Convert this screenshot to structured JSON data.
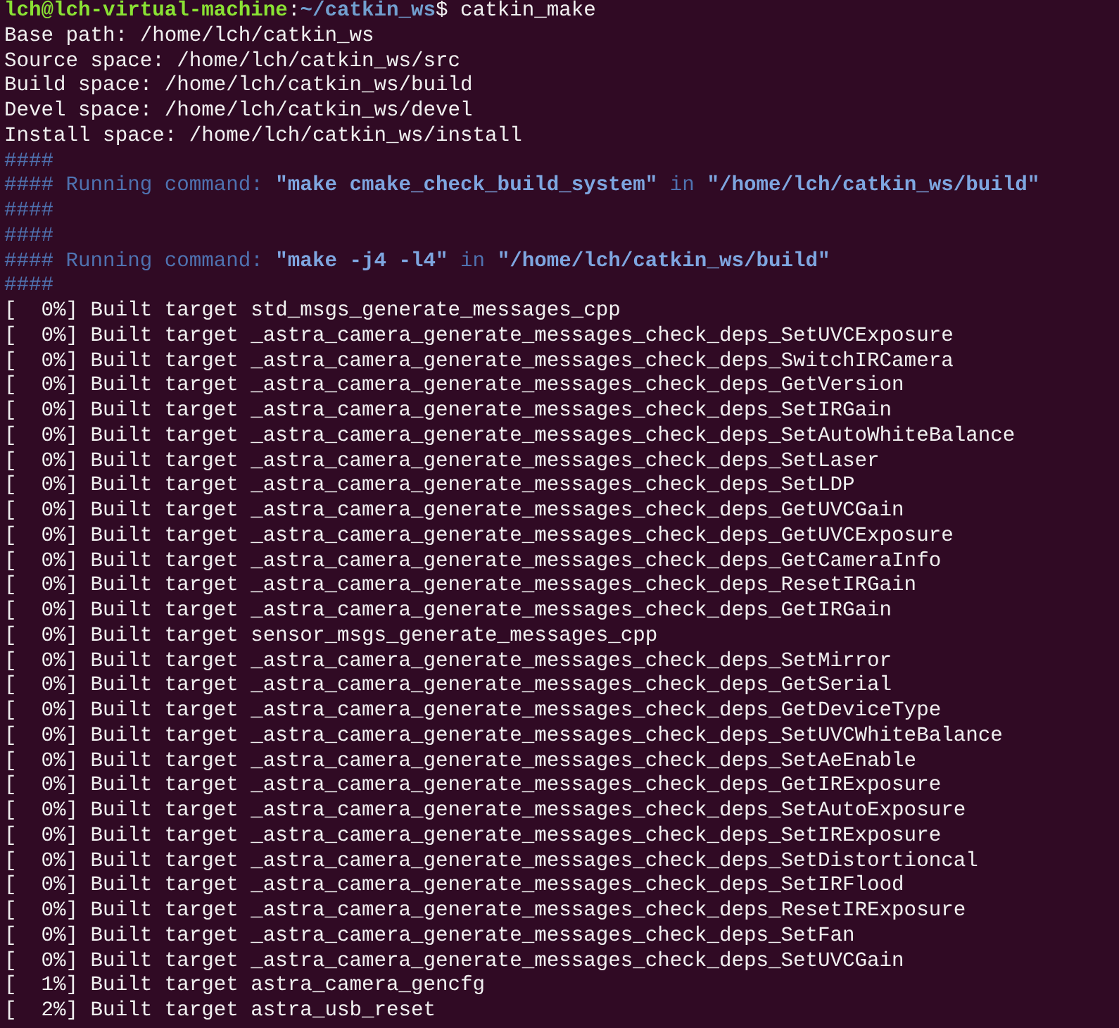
{
  "terminal": {
    "lines": [
      {
        "segments": [
          {
            "text": "lch@lch-virtual-machine",
            "kind": "user"
          },
          {
            "text": ":",
            "kind": "plain"
          },
          {
            "text": "~/catkin_ws",
            "kind": "path"
          },
          {
            "text": "$ catkin_make",
            "kind": "plain"
          }
        ]
      },
      {
        "text": "Base path: /home/lch/catkin_ws"
      },
      {
        "text": "Source space: /home/lch/catkin_ws/src"
      },
      {
        "text": "Build space: /home/lch/catkin_ws/build"
      },
      {
        "text": "Devel space: /home/lch/catkin_ws/devel"
      },
      {
        "text": "Install space: /home/lch/catkin_ws/install"
      },
      {
        "segments": [
          {
            "text": "####",
            "kind": "info"
          }
        ]
      },
      {
        "segments": [
          {
            "text": "#### Running command: ",
            "kind": "info"
          },
          {
            "text": "\"make cmake_check_build_system\"",
            "kind": "strong"
          },
          {
            "text": " in ",
            "kind": "info"
          },
          {
            "text": "\"/home/lch/catkin_ws/build\"",
            "kind": "strong"
          }
        ]
      },
      {
        "segments": [
          {
            "text": "####",
            "kind": "info"
          }
        ]
      },
      {
        "segments": [
          {
            "text": "####",
            "kind": "info"
          }
        ]
      },
      {
        "segments": [
          {
            "text": "#### Running command: ",
            "kind": "info"
          },
          {
            "text": "\"make -j4 -l4\"",
            "kind": "strong"
          },
          {
            "text": " in ",
            "kind": "info"
          },
          {
            "text": "\"/home/lch/catkin_ws/build\"",
            "kind": "strong"
          }
        ]
      },
      {
        "segments": [
          {
            "text": "####",
            "kind": "info"
          }
        ]
      },
      {
        "text": "[  0%] Built target std_msgs_generate_messages_cpp"
      },
      {
        "text": "[  0%] Built target _astra_camera_generate_messages_check_deps_SetUVCExposure"
      },
      {
        "text": "[  0%] Built target _astra_camera_generate_messages_check_deps_SwitchIRCamera"
      },
      {
        "text": "[  0%] Built target _astra_camera_generate_messages_check_deps_GetVersion"
      },
      {
        "text": "[  0%] Built target _astra_camera_generate_messages_check_deps_SetIRGain"
      },
      {
        "text": "[  0%] Built target _astra_camera_generate_messages_check_deps_SetAutoWhiteBalance"
      },
      {
        "text": "[  0%] Built target _astra_camera_generate_messages_check_deps_SetLaser"
      },
      {
        "text": "[  0%] Built target _astra_camera_generate_messages_check_deps_SetLDP"
      },
      {
        "text": "[  0%] Built target _astra_camera_generate_messages_check_deps_GetUVCGain"
      },
      {
        "text": "[  0%] Built target _astra_camera_generate_messages_check_deps_GetUVCExposure"
      },
      {
        "text": "[  0%] Built target _astra_camera_generate_messages_check_deps_GetCameraInfo"
      },
      {
        "text": "[  0%] Built target _astra_camera_generate_messages_check_deps_ResetIRGain"
      },
      {
        "text": "[  0%] Built target _astra_camera_generate_messages_check_deps_GetIRGain"
      },
      {
        "text": "[  0%] Built target sensor_msgs_generate_messages_cpp"
      },
      {
        "text": "[  0%] Built target _astra_camera_generate_messages_check_deps_SetMirror"
      },
      {
        "text": "[  0%] Built target _astra_camera_generate_messages_check_deps_GetSerial"
      },
      {
        "text": "[  0%] Built target _astra_camera_generate_messages_check_deps_GetDeviceType"
      },
      {
        "text": "[  0%] Built target _astra_camera_generate_messages_check_deps_SetUVCWhiteBalance"
      },
      {
        "text": "[  0%] Built target _astra_camera_generate_messages_check_deps_SetAeEnable"
      },
      {
        "text": "[  0%] Built target _astra_camera_generate_messages_check_deps_GetIRExposure"
      },
      {
        "text": "[  0%] Built target _astra_camera_generate_messages_check_deps_SetAutoExposure"
      },
      {
        "text": "[  0%] Built target _astra_camera_generate_messages_check_deps_SetIRExposure"
      },
      {
        "text": "[  0%] Built target _astra_camera_generate_messages_check_deps_SetDistortioncal"
      },
      {
        "text": "[  0%] Built target _astra_camera_generate_messages_check_deps_SetIRFlood"
      },
      {
        "text": "[  0%] Built target _astra_camera_generate_messages_check_deps_ResetIRExposure"
      },
      {
        "text": "[  0%] Built target _astra_camera_generate_messages_check_deps_SetFan"
      },
      {
        "text": "[  0%] Built target _astra_camera_generate_messages_check_deps_SetUVCGain"
      },
      {
        "text": "[  1%] Built target astra_camera_gencfg"
      },
      {
        "text": "[  2%] Built target astra_usb_reset"
      }
    ]
  }
}
